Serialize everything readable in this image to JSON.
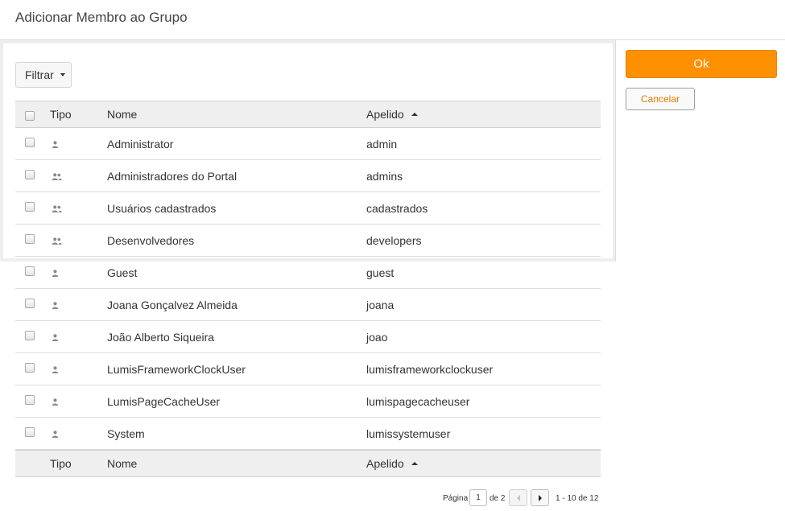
{
  "dialog": {
    "title": "Adicionar Membro ao Grupo"
  },
  "toolbar": {
    "filter_label": "Filtrar"
  },
  "grid": {
    "headers": {
      "type": "Tipo",
      "name": "Nome",
      "nick": "Apelido"
    },
    "sort": {
      "column": "Apelido",
      "direction": "ascending"
    },
    "rows": [
      {
        "type": "user",
        "name": "Administrator",
        "nick": "admin"
      },
      {
        "type": "group",
        "name": "Administradores do Portal",
        "nick": "admins"
      },
      {
        "type": "group",
        "name": "Usuários cadastrados",
        "nick": "cadastrados"
      },
      {
        "type": "group",
        "name": "Desenvolvedores",
        "nick": "developers"
      },
      {
        "type": "user",
        "name": "Guest",
        "nick": "guest"
      },
      {
        "type": "user",
        "name": "Joana Gonçalvez Almeida",
        "nick": "joana"
      },
      {
        "type": "user",
        "name": "João Alberto Siqueira",
        "nick": "joao"
      },
      {
        "type": "user",
        "name": "LumisFrameworkClockUser",
        "nick": "lumisframeworkclockuser"
      },
      {
        "type": "user",
        "name": "LumisPageCacheUser",
        "nick": "lumispagecacheuser"
      },
      {
        "type": "user",
        "name": "System",
        "nick": "lumissystemuser"
      }
    ]
  },
  "pager": {
    "page_label": "Página",
    "current_page": "1",
    "of_label": "de 2",
    "range": "1 - 10 de 12"
  },
  "actions": {
    "ok_label": "Ok",
    "cancel_label": "Cancelar"
  },
  "colors": {
    "accent": "#ff9000",
    "cancel_text": "#e07800"
  },
  "icons": {
    "user": "user-icon",
    "group": "group-icon",
    "prev": "prev-page-icon",
    "next": "next-page-icon",
    "sort": "sort-asc-icon"
  }
}
